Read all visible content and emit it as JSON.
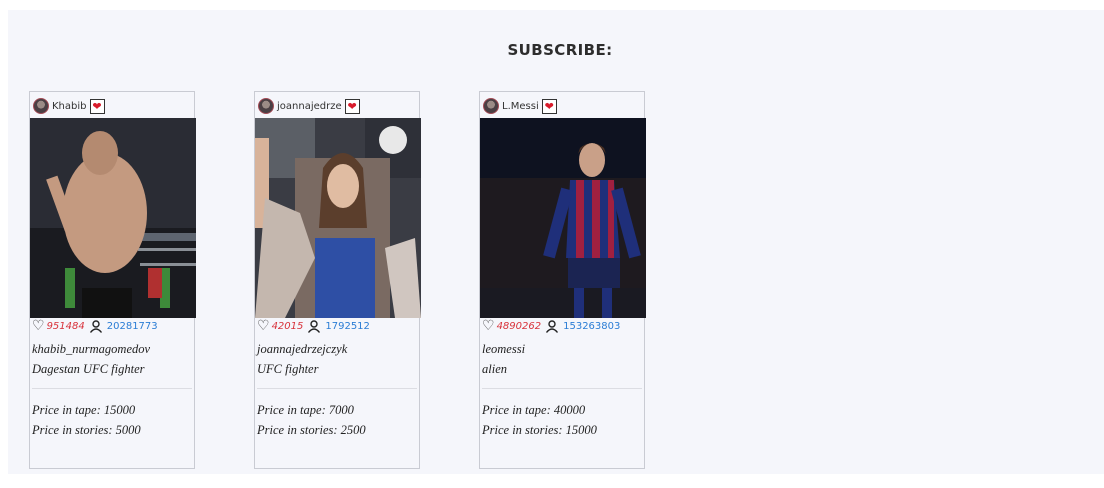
{
  "heading": "SUBSCRIBE:",
  "cards": [
    {
      "name": "Khabib",
      "likes": "951484",
      "subscribers": "20281773",
      "handle": "khabib_nurmagomedov",
      "description": "Dagestan UFC fighter",
      "price_tape": "Price in tape: 15000",
      "price_stories": "Price in stories: 5000"
    },
    {
      "name": "joannajedrze",
      "likes": "42015",
      "subscribers": "1792512",
      "handle": "joannajedrzejczyk",
      "description": "UFC fighter",
      "price_tape": "Price in tape: 7000",
      "price_stories": "Price in stories: 2500"
    },
    {
      "name": "L.Messi",
      "likes": "4890262",
      "subscribers": "153263803",
      "handle": "leomessi",
      "description": "alien",
      "price_tape": "Price in tape: 40000",
      "price_stories": "Price in stories: 15000"
    }
  ],
  "icons": {
    "favorite": "heart-filled-icon",
    "likes": "heart-outline-icon",
    "subscribers": "person-icon"
  },
  "colors": {
    "likes": "#d8323b",
    "subscribers": "#2b7dd5",
    "favorite_heart": "#d81b2c",
    "panel_bg": "#f5f6fb"
  }
}
